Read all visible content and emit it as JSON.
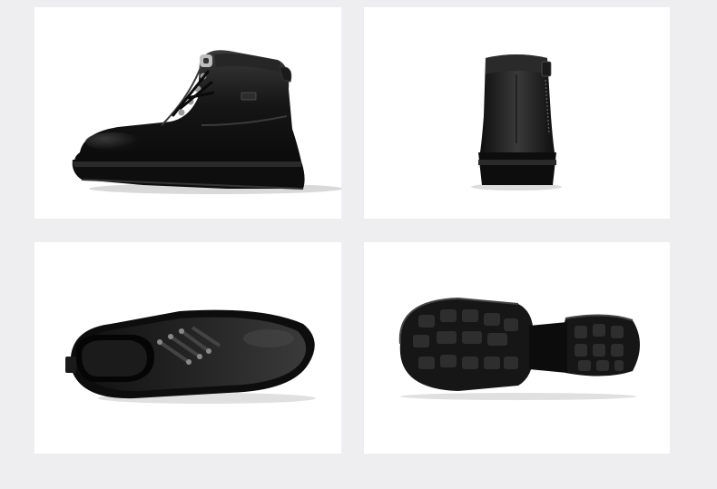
{
  "page": {
    "background_color": "#eeeef0",
    "panel_color": "#ffffff"
  },
  "gallery": {
    "views": [
      {
        "view": "side",
        "subject": "boot-side-view"
      },
      {
        "view": "back",
        "subject": "boot-back-view"
      },
      {
        "view": "top",
        "subject": "boot-top-view"
      },
      {
        "view": "sole",
        "subject": "boot-sole-view"
      }
    ]
  },
  "product": {
    "color": "#151515",
    "material_look": "black leather",
    "sole_color": "#1a1a1a"
  }
}
